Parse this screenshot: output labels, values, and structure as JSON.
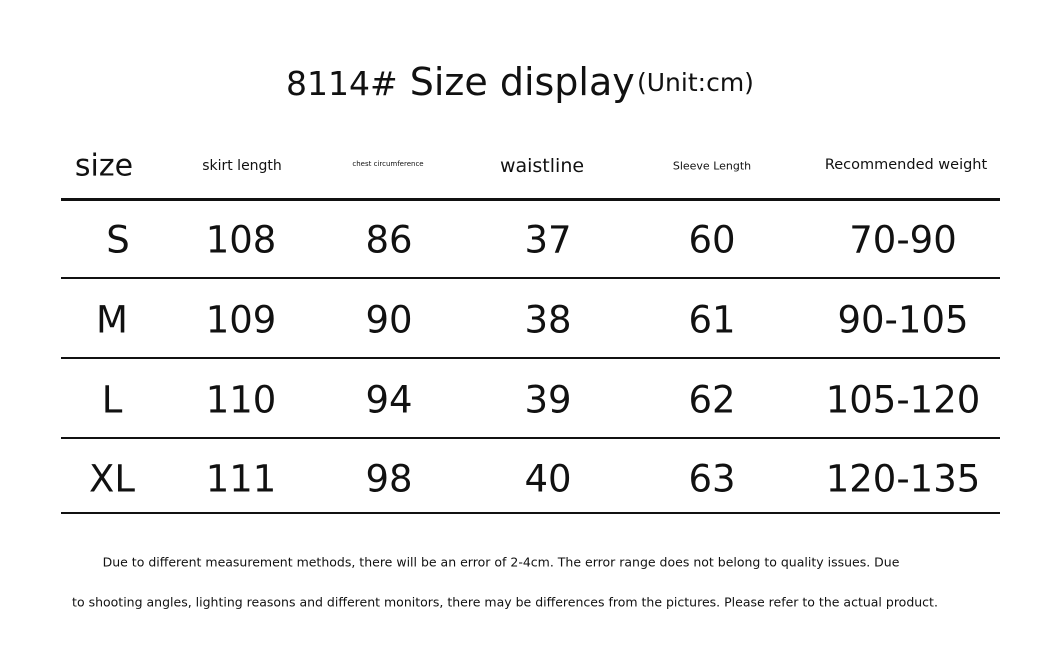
{
  "title": {
    "code": "8114#",
    "text": "Size display",
    "unit": "(Unit:cm)"
  },
  "table": {
    "headers": [
      "size",
      "skirt length",
      "chest circumference",
      "waistline",
      "Sleeve Length",
      "Recommended weight"
    ],
    "rows": [
      [
        "S",
        "108",
        "86",
        "37",
        "60",
        "70-90"
      ],
      [
        "M",
        "109",
        "90",
        "38",
        "61",
        "90-105"
      ],
      [
        "L",
        "110",
        "94",
        "39",
        "62",
        "105-120"
      ],
      [
        "XL",
        "111",
        "98",
        "40",
        "63",
        "120-135"
      ]
    ]
  },
  "notes": [
    "Due to different measurement methods, there will be an error of 2-4cm. The error range does not belong to quality issues. Due",
    "to shooting angles, lighting reasons and different monitors, there may be differences from the pictures. Please refer to the actual product."
  ]
}
